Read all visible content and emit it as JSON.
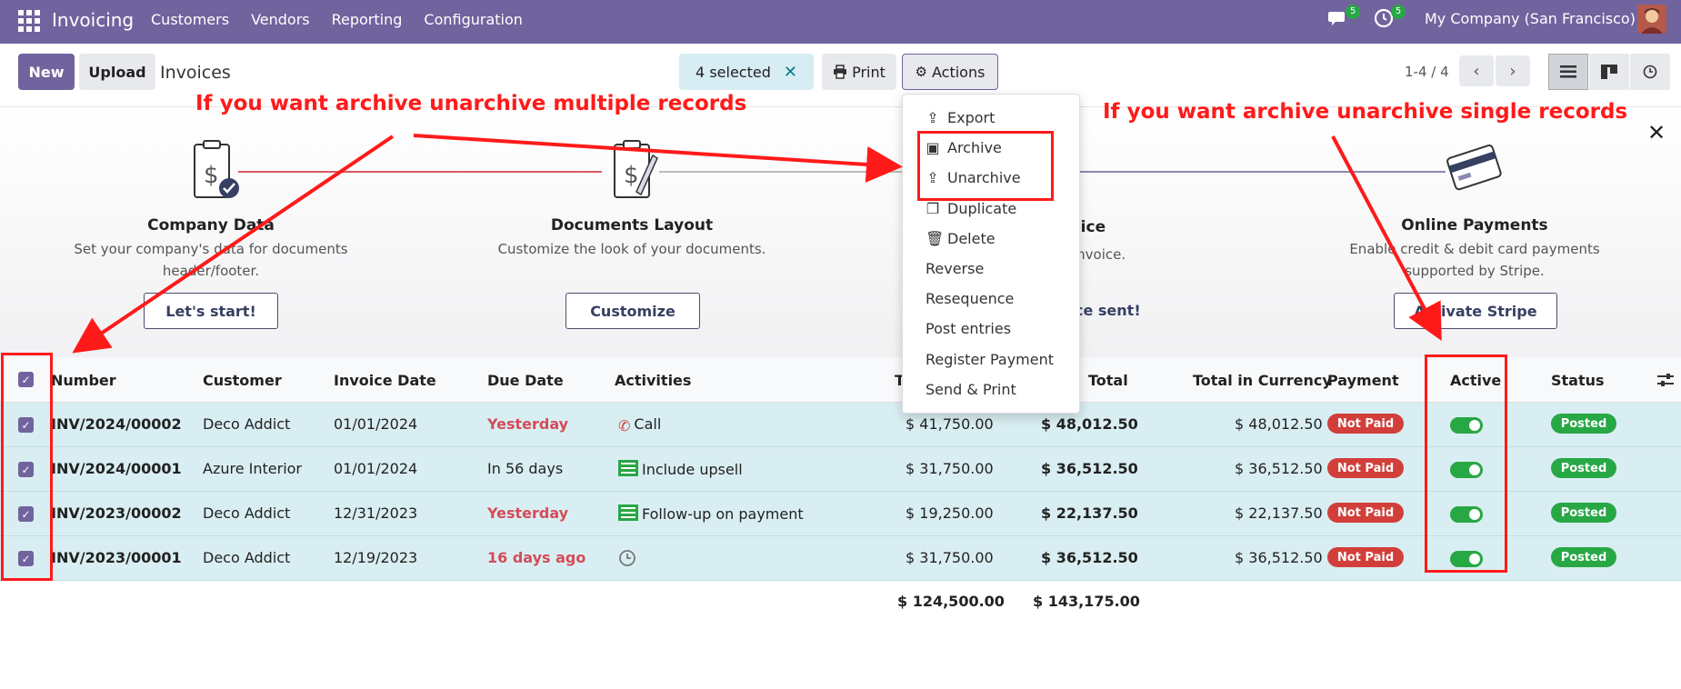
{
  "app": {
    "title": "Invoicing",
    "menu": [
      "Customers",
      "Vendors",
      "Reporting",
      "Configuration"
    ],
    "messages_count": "5",
    "activities_count": "5",
    "company": "My Company (San Francisco)"
  },
  "control": {
    "new_label": "New",
    "upload_label": "Upload",
    "breadcrumb": "Invoices",
    "selected_label": "4 selected",
    "clear_label": "✕",
    "print_label": "Print",
    "actions_label": "Actions",
    "pager": "1-4 / 4"
  },
  "actions_menu": {
    "items": [
      "Export",
      "Archive",
      "Unarchive",
      "Duplicate",
      "Delete",
      "Reverse",
      "Resequence",
      "Post entries",
      "Register Payment",
      "Send & Print"
    ]
  },
  "onboarding": {
    "steps": [
      {
        "title": "Company Data",
        "desc1": "Set your company's data for documents",
        "desc2": "header/footer.",
        "button": "Let's start!"
      },
      {
        "title": "Documents Layout",
        "desc1": "Customize the look of your documents.",
        "desc2": "",
        "button": "Customize"
      },
      {
        "title": "oice",
        "desc1": "invoice.",
        "desc2": "",
        "button": "ce sent!"
      },
      {
        "title": "Online Payments",
        "desc1": "Enable credit & debit card payments",
        "desc2": "supported by Stripe.",
        "button": "Activate Stripe"
      }
    ],
    "close": "✕"
  },
  "table": {
    "headers": {
      "number": "Number",
      "customer": "Customer",
      "invoice_date": "Invoice Date",
      "due_date": "Due Date",
      "activities": "Activities",
      "tax_excl": "T",
      "total": "Total",
      "total_currency": "Total in Currency",
      "payment": "Payment",
      "active": "Active",
      "status": "Status"
    },
    "rows": [
      {
        "number": "INV/2024/00002",
        "customer": "Deco Addict",
        "invoice_date": "01/01/2024",
        "due_date": "Yesterday",
        "due_overdue": true,
        "activity_icon": "phone-icon",
        "activity": "Call",
        "untaxed": "$ 41,750.00",
        "total": "$ 48,012.50",
        "total_currency": "$ 48,012.50",
        "payment": "Not Paid",
        "active": true,
        "status": "Posted"
      },
      {
        "number": "INV/2024/00001",
        "customer": "Azure Interior",
        "invoice_date": "01/01/2024",
        "due_date": "In 56 days",
        "due_overdue": false,
        "activity_icon": "todo-list-icon",
        "activity": "Include upsell",
        "untaxed": "$ 31,750.00",
        "total": "$ 36,512.50",
        "total_currency": "$ 36,512.50",
        "payment": "Not Paid",
        "active": true,
        "status": "Posted"
      },
      {
        "number": "INV/2023/00002",
        "customer": "Deco Addict",
        "invoice_date": "12/31/2023",
        "due_date": "Yesterday",
        "due_overdue": true,
        "activity_icon": "todo-list-icon",
        "activity": "Follow-up on payment",
        "untaxed": "$ 19,250.00",
        "total": "$ 22,137.50",
        "total_currency": "$ 22,137.50",
        "payment": "Not Paid",
        "active": true,
        "status": "Posted"
      },
      {
        "number": "INV/2023/00001",
        "customer": "Deco Addict",
        "invoice_date": "12/19/2023",
        "due_date": "16 days ago",
        "due_overdue": true,
        "activity_icon": "clock-icon",
        "activity": "",
        "untaxed": "$ 31,750.00",
        "total": "$ 36,512.50",
        "total_currency": "$ 36,512.50",
        "payment": "Not Paid",
        "active": true,
        "status": "Posted"
      }
    ],
    "totals": {
      "untaxed": "$ 124,500.00",
      "total": "$ 143,175.00"
    }
  },
  "annotations": {
    "multiple": "If you want archive unarchive multiple records",
    "single": "If you want archive unarchive single records",
    "color": "#ff1a1a"
  },
  "colors": {
    "brand": "#71639e",
    "selected_row": "#d9eef2",
    "danger": "#d23f3a",
    "success": "#28a745"
  }
}
